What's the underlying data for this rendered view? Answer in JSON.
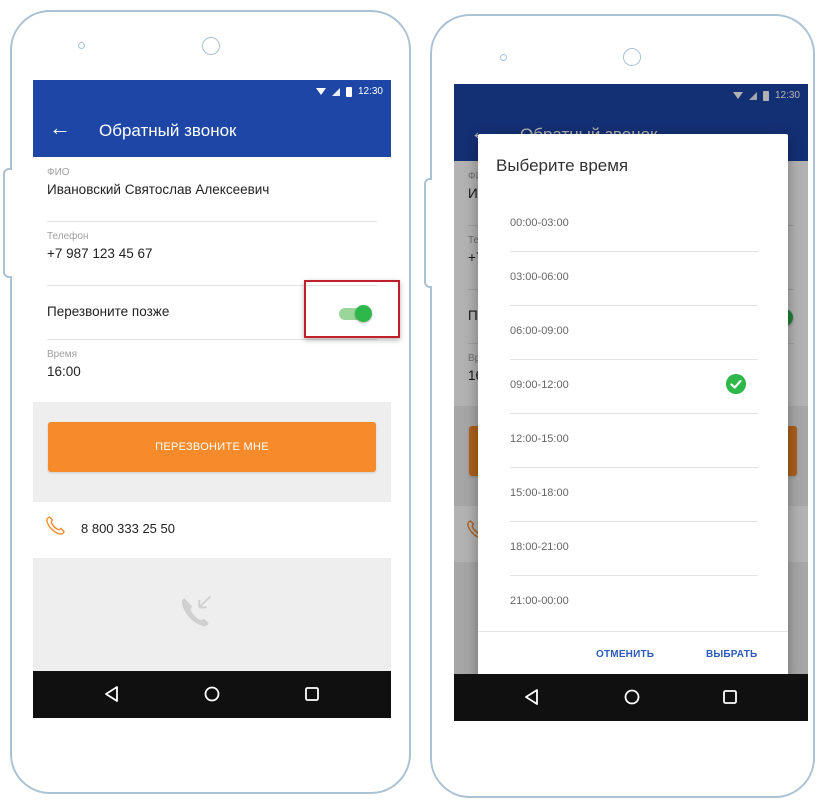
{
  "colors": {
    "primary_blue": "#1d46a6",
    "accent_orange": "#f78a2a",
    "toggle_green": "#2eb84b",
    "highlight_red": "#c0202a",
    "link_blue": "#2d5bb8"
  },
  "screen1": {
    "status_time": "12:30",
    "title": "Обратный звонок",
    "fields": [
      {
        "label": "ФИО",
        "value": "Ивановский Святослав Алексеевич"
      },
      {
        "label": "Телефон",
        "value": "+7 987 123 45 67"
      },
      {
        "label": "",
        "value": "Перезвоните позже"
      },
      {
        "label": "Время",
        "value": "16:00"
      }
    ],
    "toggle_on": true,
    "cta_label": "ПЕРЕЗВОНИТЕ МНЕ",
    "hotline": "8 800 333 25 50"
  },
  "screen2": {
    "status_time": "12:30",
    "dialog": {
      "title": "Выберите время",
      "options": [
        {
          "label": "00:00-03:00",
          "selected": false
        },
        {
          "label": "03:00-06:00",
          "selected": false
        },
        {
          "label": "06:00-09:00",
          "selected": false
        },
        {
          "label": "09:00-12:00",
          "selected": true
        },
        {
          "label": "12:00-15:00",
          "selected": false
        },
        {
          "label": "15:00-18:00",
          "selected": false
        },
        {
          "label": "18:00-21:00",
          "selected": false
        },
        {
          "label": "21:00-00:00",
          "selected": false
        }
      ],
      "cancel_label": "ОТМЕНИТЬ",
      "confirm_label": "ВЫБРАТЬ"
    }
  },
  "icons": {
    "back": "arrow-left-icon",
    "phone": "phone-icon",
    "check": "check-circle-icon",
    "nav_back": "triangle-back-icon",
    "nav_home": "circle-home-icon",
    "nav_recent": "square-recent-icon"
  }
}
